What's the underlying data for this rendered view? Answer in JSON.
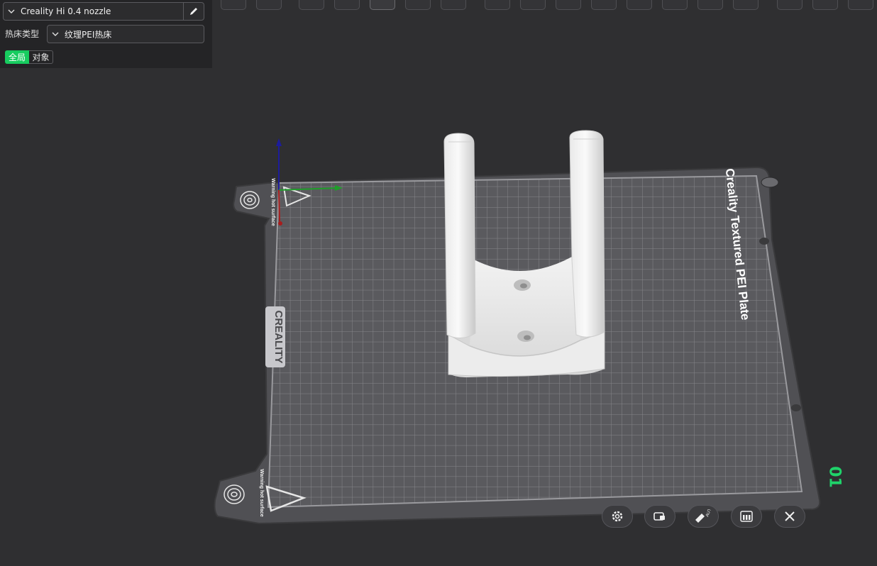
{
  "sidebar": {
    "printer": {
      "value": "Creality Hi 0.4 nozzle"
    },
    "bed_type": {
      "label": "热床类型",
      "value": "纹理PEI热床"
    },
    "scope_tabs": {
      "global": "全局",
      "object": "对象"
    }
  },
  "plate": {
    "name_text": "Creality Textured PEI Plate",
    "brand_text": "CREALITY",
    "warning_text": "Warning hot surface",
    "number": "01"
  },
  "bottom_toolbar": {
    "auto_label": "AUTO",
    "buttons": [
      "settings",
      "lock-plate",
      "auto-orient",
      "arrange",
      "delete"
    ]
  },
  "colors": {
    "accent": "#17cc5f",
    "background": "#2f2f31",
    "panel": "#242426",
    "plate_number": "#1fd36a"
  }
}
